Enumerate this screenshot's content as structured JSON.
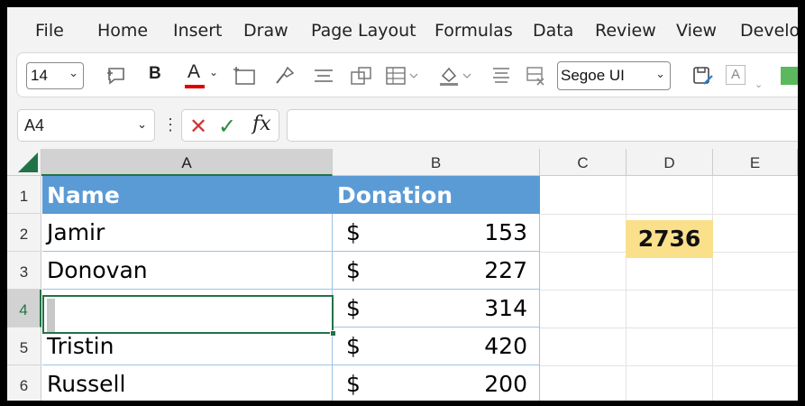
{
  "menu": [
    "File",
    "Home",
    "Insert",
    "Draw",
    "Page Layout",
    "Formulas",
    "Data",
    "Review",
    "View",
    "Develop"
  ],
  "ribbon": {
    "font_size": "14",
    "font_name": "Segoe UI",
    "bold_label": "B",
    "font_color_label": "A",
    "font_color": "#e00000",
    "style_label": "A",
    "fill_color": "#5cb85c"
  },
  "formula_bar": {
    "name_box": "A4",
    "more_dots": "⋮",
    "cancel_glyph": "✕",
    "enter_glyph": "✓",
    "fx_label": "fx",
    "formula": ""
  },
  "sheet": {
    "columns": [
      "A",
      "B",
      "C",
      "D",
      "E"
    ],
    "rows": [
      "1",
      "2",
      "3",
      "4",
      "5",
      "6"
    ],
    "selected_column": "A",
    "selected_row": "4",
    "header": {
      "name": "Name",
      "donation": "Donation"
    },
    "records": [
      {
        "name": "Jamir",
        "currency": "$",
        "amount": "153"
      },
      {
        "name": "Donovan",
        "currency": "$",
        "amount": "227"
      },
      {
        "name": "",
        "currency": "$",
        "amount": "314"
      },
      {
        "name": "Tristin",
        "currency": "$",
        "amount": "420"
      },
      {
        "name": "Russell",
        "currency": "$",
        "amount": "200"
      }
    ],
    "total": "2736",
    "colors": {
      "header_fill": "#5b9bd5",
      "total_fill": "#fbe08c",
      "accent": "#217346"
    }
  }
}
